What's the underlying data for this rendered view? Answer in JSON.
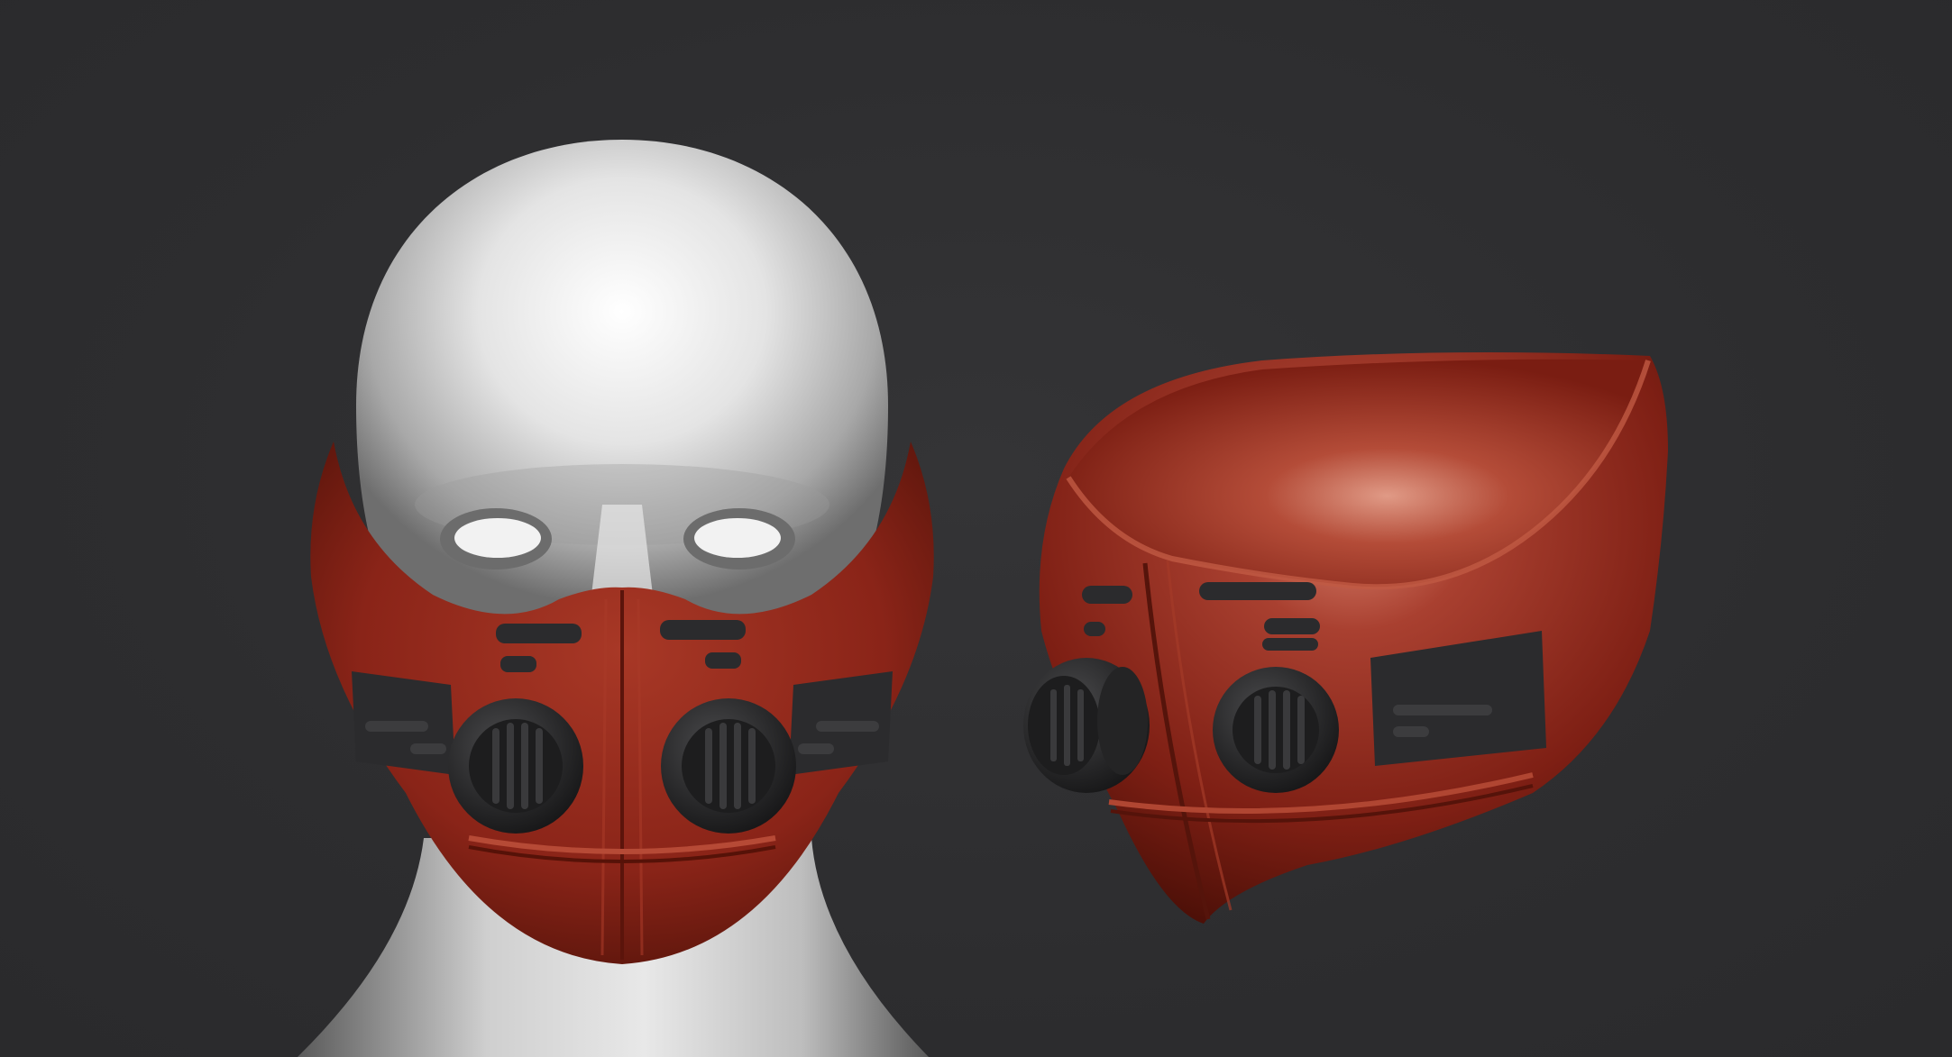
{
  "scene": {
    "background_color": "#2e2e30",
    "objects": [
      {
        "name": "head-with-mask-front-view",
        "type": "3d-render"
      },
      {
        "name": "mask-three-quarter-view",
        "type": "3d-render"
      }
    ],
    "colors": {
      "skin": "#e6e6e6",
      "mask": "#8a2418",
      "mask_highlight": "#c9604c",
      "hardware": "#2b2b2d"
    }
  }
}
